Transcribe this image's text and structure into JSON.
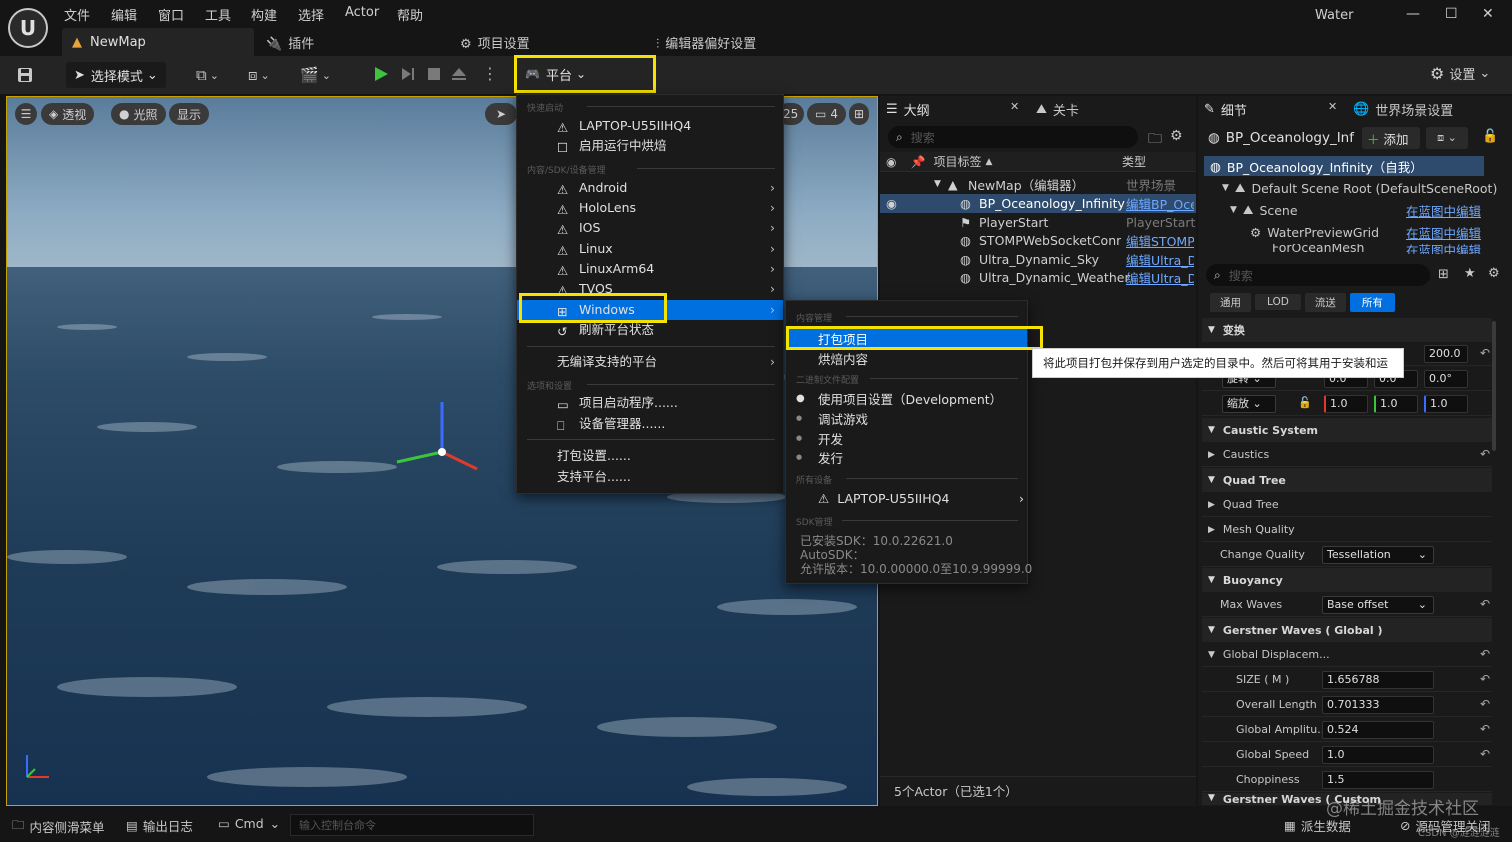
{
  "app": {
    "logo": "U",
    "title": "Water",
    "map_tab": "NewMap"
  },
  "menubar": [
    "文件",
    "编辑",
    "窗口",
    "工具",
    "构建",
    "选择",
    "Actor",
    "帮助"
  ],
  "tabs": {
    "plugins": "插件",
    "project_settings": "项目设置",
    "editor_prefs": "编辑器偏好设置"
  },
  "toolbar": {
    "select_mode": "选择模式",
    "platform": "平台",
    "settings": "设置"
  },
  "viewport": {
    "perspective": "透视",
    "lit": "光照",
    "show": "显示",
    "num1": "25",
    "num2": "4"
  },
  "platform_menu": {
    "h_quick": "快速启动",
    "device": "LAPTOP-U55IIHQ4",
    "bake_runtime": "启用运行中烘焙",
    "h_content": "内容/SDK/设备管理",
    "platforms": [
      "Android",
      "HoloLens",
      "IOS",
      "Linux",
      "LinuxArm64",
      "TVOS",
      "Windows"
    ],
    "refresh": "刷新平台状态",
    "no_compile": "无编译支持的平台",
    "h_options": "选项和设置",
    "launcher": "项目启动程序......",
    "device_mgr": "设备管理器......",
    "package_settings": "打包设置......",
    "supported": "支持平台......"
  },
  "sub_menu": {
    "h_content": "内容管理",
    "package": "打包项目",
    "cook": "烘焙内容",
    "h_binary": "二进制文件配置",
    "configs": [
      "使用项目设置（Development）",
      "调试游戏",
      "开发",
      "发行"
    ],
    "h_devices": "所有设备",
    "device": "LAPTOP-U55IIHQ4",
    "h_sdk": "SDK管理",
    "sdk_installed": "已安装SDK：10.0.22621.0",
    "autosdk": "AutoSDK：",
    "allowed": "允许版本：10.0.00000.0至10.9.99999.0"
  },
  "tooltip": "将此项目打包并保存到用户选定的目录中。然后可将其用于安装和运行。",
  "outliner": {
    "tab": "大纲",
    "tab2": "关卡",
    "search_placeholder": "搜索",
    "col_label": "项目标签",
    "col_type": "类型",
    "rows": [
      {
        "name": "NewMap（编辑器）",
        "type": "世界场景",
        "link": false
      },
      {
        "name": "BP_Oceanology_Infinity",
        "type": "编辑BP_Oce",
        "link": true
      },
      {
        "name": "PlayerStart",
        "type": "PlayerStart",
        "link": false
      },
      {
        "name": "STOMPWebSocketConnec",
        "type": "编辑STOMP",
        "link": true
      },
      {
        "name": "Ultra_Dynamic_Sky",
        "type": "编辑Ultra_D",
        "link": true
      },
      {
        "name": "Ultra_Dynamic_Weather",
        "type": "编辑Ultra_D",
        "link": true
      }
    ],
    "footer": "5个Actor（已选1个）"
  },
  "details": {
    "tab": "细节",
    "tab2": "世界场景设置",
    "actor": "BP_Oceanology_Inf",
    "add": "添加",
    "self": "BP_Oceanology_Infinity（自我）",
    "root": "Default Scene Root (DefaultSceneRoot)",
    "scene": "Scene",
    "edit_bp": "在蓝图中编辑",
    "water_grid": "WaterPreviewGrid",
    "cut": "ForOceanMesh",
    "search_placeholder": "搜索",
    "filters": [
      "通用",
      "LOD",
      "流送",
      "所有"
    ],
    "transform": "变换",
    "rot_label": "旋转",
    "scale_label": "缩放",
    "loc_z": "200.0",
    "rot_vals": [
      "0.0°",
      "0.0°",
      "0.0°"
    ],
    "scale_vals": [
      "1.0",
      "1.0",
      "1.0"
    ],
    "caustic_system": "Caustic System",
    "caustics": "Caustics",
    "quad_tree_h": "Quad Tree",
    "quad_tree": "Quad Tree",
    "mesh_quality": "Mesh Quality",
    "change_quality": "Change Quality",
    "change_quality_val": "Tessellation",
    "buoyancy": "Buoyancy",
    "max_waves": "Max Waves",
    "max_waves_val": "Base offset",
    "gerstner": "Gerstner Waves ( Global )",
    "global_disp": "Global Displacem...",
    "size_label": "SIZE ( M )",
    "size_val": "1.656788",
    "overall_length": "Overall Length",
    "overall_length_val": "0.701333",
    "global_amp": "Global Amplitu...",
    "global_amp_val": "0.524",
    "global_speed": "Global Speed",
    "global_speed_val": "1.0",
    "choppiness": "Choppiness",
    "choppiness_val": "1.5",
    "gerstner_custom": "Gerstner Waves ( Custom"
  },
  "statusbar": {
    "content_drawer": "内容侧滑菜单",
    "output_log": "输出日志",
    "cmd": "Cmd",
    "cmd_placeholder": "输入控制台命令",
    "derived": "派生数据",
    "source_control": "源码管理关闭",
    "watermark": "@稀土掘金技术社区",
    "watermark2": "CSDN @涟涟涟涟"
  },
  "colors": {
    "accent": "#0070e0",
    "highlight": "#f5e200",
    "link": "#6ea8ff"
  }
}
